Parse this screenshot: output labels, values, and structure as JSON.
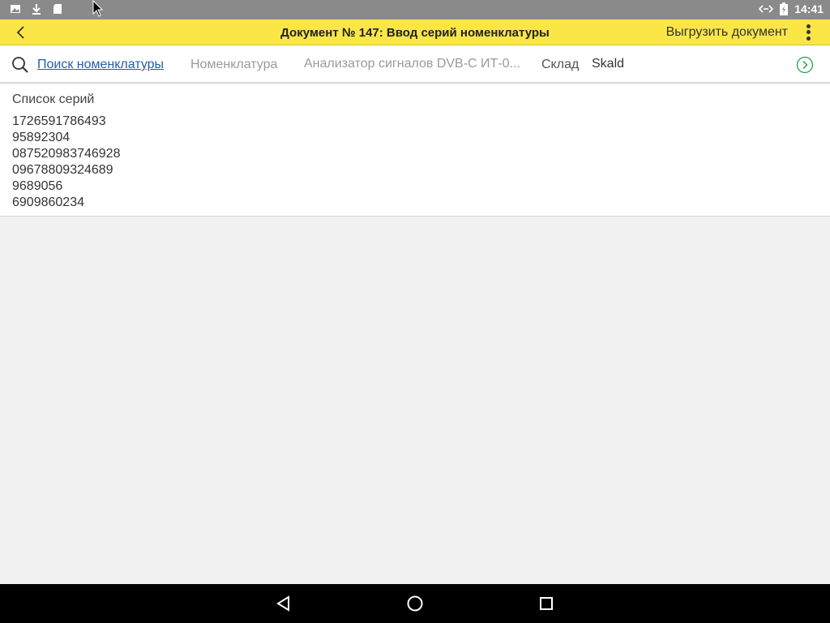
{
  "status_bar": {
    "icons_left": [
      "image-icon",
      "download-icon",
      "sd-card-icon"
    ],
    "time": "14:41"
  },
  "header": {
    "title": "Документ № 147: Ввод серий номенклатуры",
    "export_label": "Выгрузить документ"
  },
  "filter": {
    "search_link": "Поиск номенклатуры",
    "nomenclature_label": "Номенклатура",
    "nomenclature_value": "Анализатор сигналов DVB-C ИТ-0...",
    "warehouse_label": "Склад",
    "warehouse_value": "Skald"
  },
  "series": {
    "label": "Список серий",
    "items": [
      "1726591786493",
      "95892304",
      "087520983746928",
      "09678809324689",
      "9689056",
      "6909860234"
    ]
  },
  "colors": {
    "header_bg": "#fbe648",
    "link": "#1f5fa8",
    "go_button": "#2e9e57"
  }
}
